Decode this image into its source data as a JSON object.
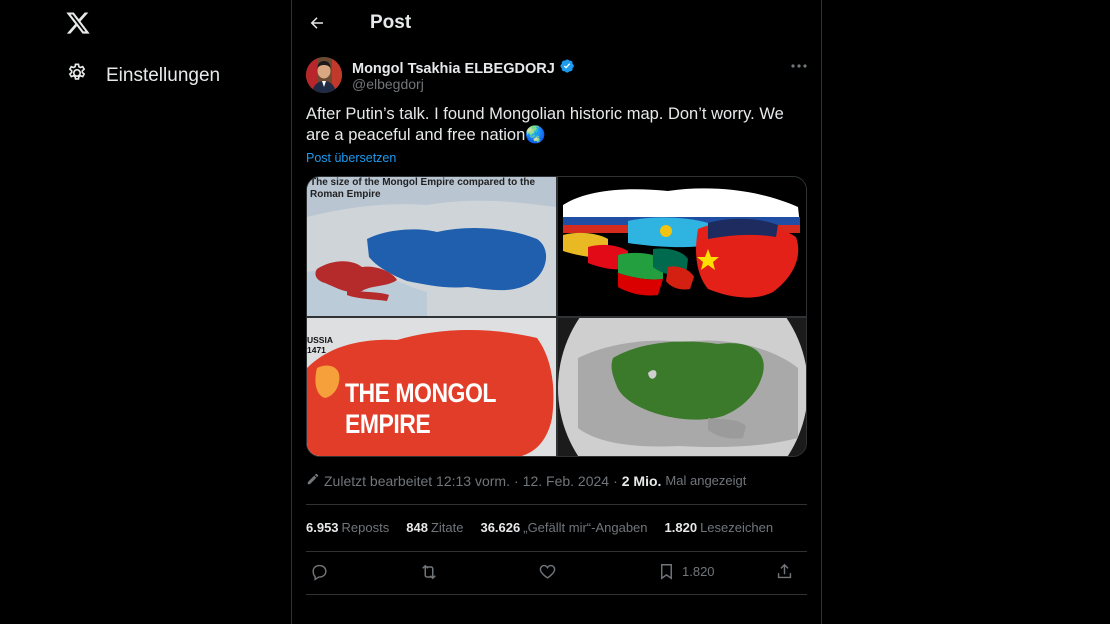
{
  "nav": {
    "logo_icon": "x-logo-icon",
    "settings_label": "Einstellungen",
    "settings_icon": "gear-icon"
  },
  "header": {
    "title": "Post",
    "back_icon": "arrow-left-icon"
  },
  "post": {
    "author_name": "Mongol Tsakhia ELBEGDORJ",
    "verified_icon": "verified-badge-icon",
    "handle": "@elbegdorj",
    "text": "After Putin’s talk. I found Mongolian historic map. Don’t worry. We are a peaceful and free nation🌏",
    "translate_label": "Post übersetzen",
    "media": {
      "tile1_caption": "The size of the Mongol Empire compared to the Roman Empire",
      "tile3_label_russia": "USSIA\n1471",
      "tile3_title": "THE MONGOL EMPIRE"
    },
    "meta": {
      "edited_icon": "pencil-icon",
      "edited_text": "Zuletzt bearbeitet 12:13 vorm.",
      "sep1": "·",
      "date": "12. Feb. 2024",
      "sep2": "·",
      "views_count": "2 Mio.",
      "views_label": "Mal angezeigt"
    },
    "stats": [
      {
        "num": "6.953",
        "label": "Reposts"
      },
      {
        "num": "848",
        "label": "Zitate"
      },
      {
        "num": "36.626",
        "label": "„Gefällt mir“-Angaben"
      },
      {
        "num": "1.820",
        "label": "Lesezeichen"
      }
    ],
    "actions": {
      "reply_icon": "reply-icon",
      "repost_icon": "repost-icon",
      "like_icon": "heart-icon",
      "bookmark_icon": "bookmark-icon",
      "bookmark_count": "1.820",
      "share_icon": "share-icon"
    }
  },
  "colors": {
    "background": "#000000",
    "text": "#e7e9ea",
    "muted": "#71767b",
    "accent": "#1d9bf0",
    "border": "#2f3336"
  }
}
